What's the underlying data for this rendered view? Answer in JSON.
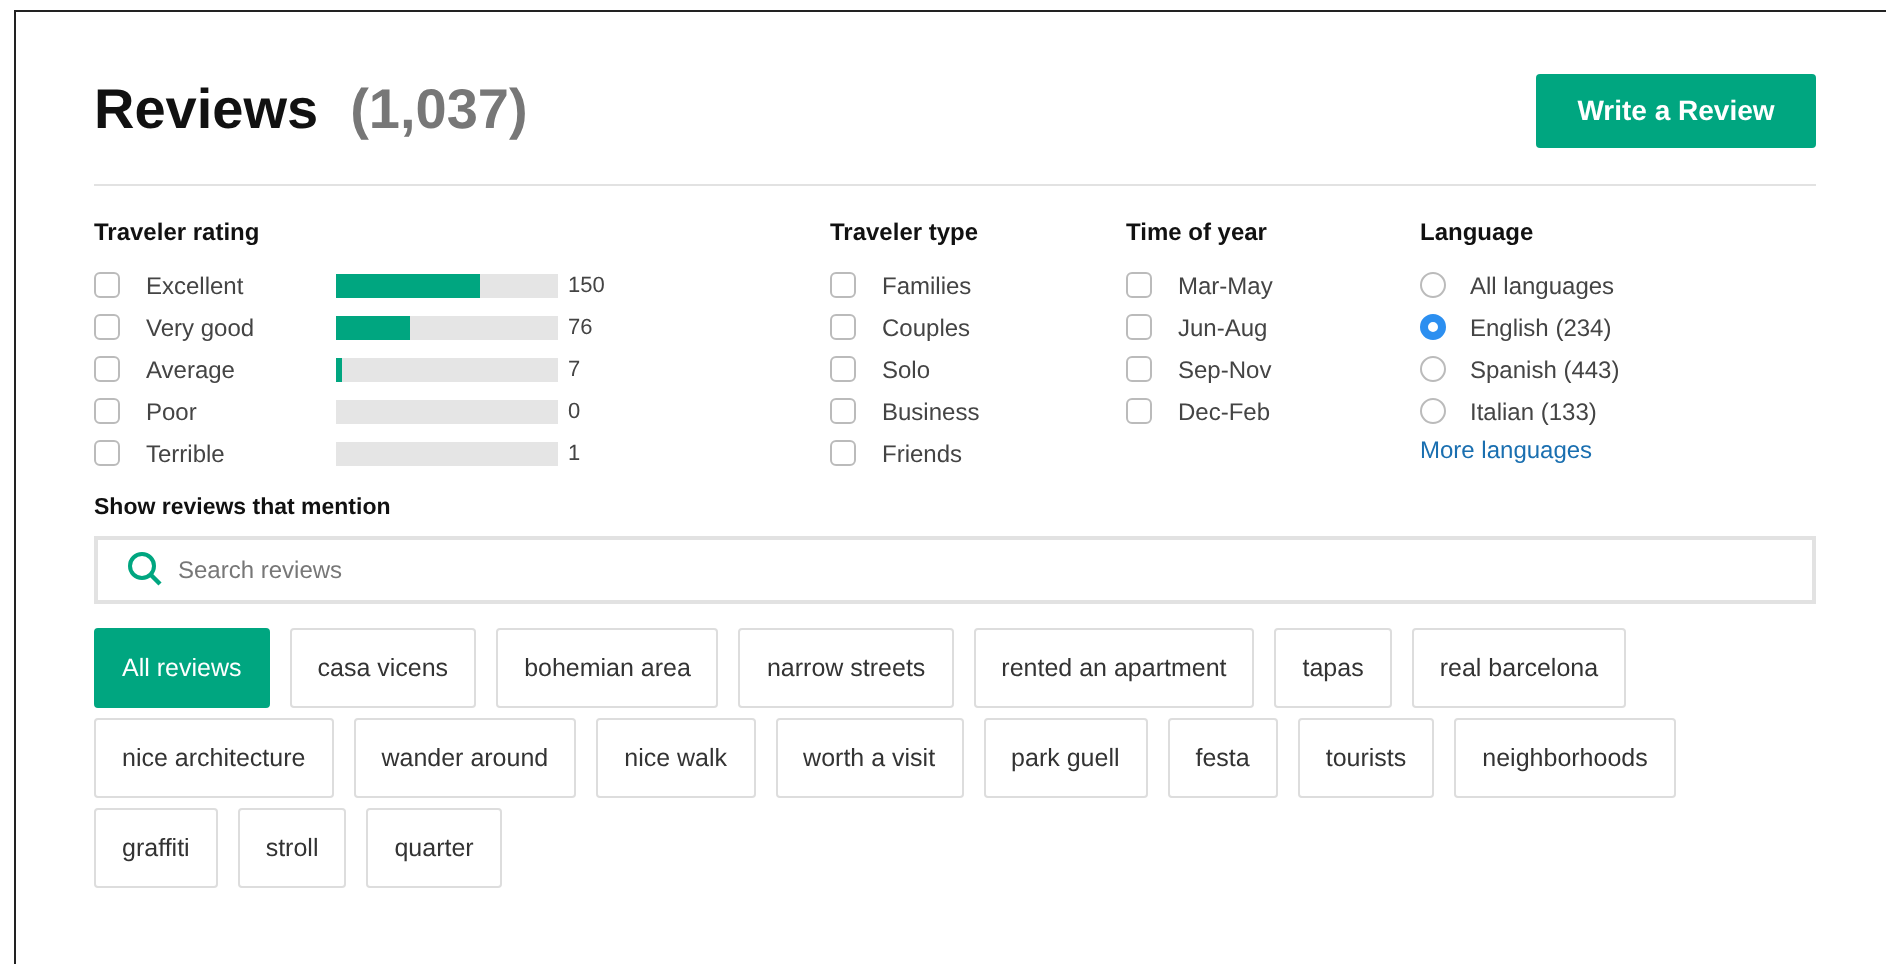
{
  "header": {
    "title": "Reviews",
    "count": "(1,037)",
    "button": "Write a Review"
  },
  "filters": [
    {
      "kind": "rating",
      "title": "Traveler rating",
      "items": [
        {
          "label": "Excellent",
          "checked": false,
          "level": 0.65,
          "count": "150"
        },
        {
          "label": "Very good",
          "checked": false,
          "level": 0.33,
          "count": "76"
        },
        {
          "label": "Average",
          "checked": false,
          "level": 0.03,
          "count": "7"
        },
        {
          "label": "Poor",
          "checked": false,
          "level": 0,
          "count": "0"
        },
        {
          "label": "Terrible",
          "checked": false,
          "level": 0,
          "count": "1"
        }
      ]
    },
    {
      "kind": "checkbox",
      "title": "Traveler type",
      "items": [
        {
          "label": "Families",
          "checked": false
        },
        {
          "label": "Couples",
          "checked": false
        },
        {
          "label": "Solo",
          "checked": false
        },
        {
          "label": "Business",
          "checked": false
        },
        {
          "label": "Friends",
          "checked": false
        }
      ]
    },
    {
      "kind": "checkbox",
      "title": "Time of year",
      "items": [
        {
          "label": "Mar-May",
          "checked": false
        },
        {
          "label": "Jun-Aug",
          "checked": false
        },
        {
          "label": "Sep-Nov",
          "checked": false
        },
        {
          "label": "Dec-Feb",
          "checked": false
        }
      ]
    },
    {
      "kind": "radio",
      "title": "Language",
      "items": [
        {
          "label": "All languages",
          "selected": false
        },
        {
          "label": "English (234)",
          "selected": true
        },
        {
          "label": "Spanish (443)",
          "selected": false
        },
        {
          "label": "Italian (133)",
          "selected": false
        }
      ],
      "link": "More languages"
    }
  ],
  "mention": {
    "title": "Show reviews that mention",
    "placeholder": "Search reviews",
    "tags": [
      {
        "label": "All reviews",
        "selected": true
      },
      {
        "label": "casa vicens",
        "selected": false
      },
      {
        "label": "bohemian area",
        "selected": false
      },
      {
        "label": "narrow streets",
        "selected": false
      },
      {
        "label": "rented an apartment",
        "selected": false
      },
      {
        "label": "tapas",
        "selected": false
      },
      {
        "label": "real barcelona",
        "selected": false
      },
      {
        "label": "nice architecture",
        "selected": false
      },
      {
        "label": "wander around",
        "selected": false
      },
      {
        "label": "nice walk",
        "selected": false
      },
      {
        "label": "worth a visit",
        "selected": false
      },
      {
        "label": "park guell",
        "selected": false
      },
      {
        "label": "festa",
        "selected": false
      },
      {
        "label": "tourists",
        "selected": false
      },
      {
        "label": "neighborhoods",
        "selected": false
      },
      {
        "label": "graffiti",
        "selected": false
      },
      {
        "label": "stroll",
        "selected": false
      },
      {
        "label": "quarter",
        "selected": false
      }
    ]
  }
}
